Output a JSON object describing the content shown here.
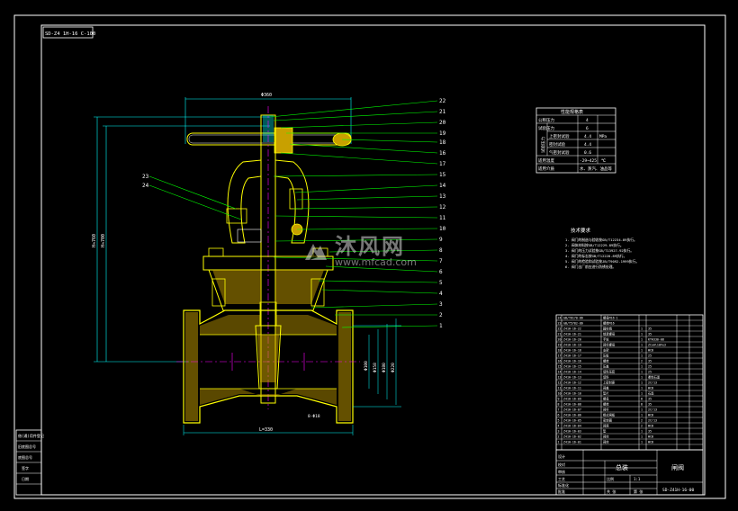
{
  "drawing": {
    "drawing_code": "SD-Z4 1H-16 C-100",
    "dims": {
      "handwheel_dia": "Φ360",
      "height_open": "H≈760",
      "height_closed": "H≈700",
      "length": "L=330",
      "bolt_holes": "8-Φ18",
      "flange_dias": [
        "Φ100",
        "Φ158",
        "Φ180",
        "Φ220"
      ]
    },
    "balloons": [
      "22",
      "21",
      "20",
      "19",
      "18",
      "16",
      "17",
      "15",
      "14",
      "13",
      "12",
      "11",
      "10",
      "9",
      "8",
      "7",
      "6",
      "5",
      "4",
      "3",
      "2",
      "1"
    ],
    "balloons_left": [
      "23",
      "24"
    ]
  },
  "perf_table": {
    "title": "性能规格表",
    "rows": [
      {
        "label": "公称压力",
        "value": "4",
        "unit": ""
      },
      {
        "label": "试验压力",
        "value": "6",
        "unit": ""
      },
      {
        "label": "上密封试验",
        "value": "4.4",
        "unit": "MPa"
      },
      {
        "label": "密封试验",
        "value": "4.4",
        "unit": ""
      },
      {
        "label": "气密封试验",
        "value": "0.6",
        "unit": ""
      }
    ],
    "side_label": "试验压力",
    "temp_label": "适用温度",
    "temp_value": "-29~425",
    "temp_unit": "℃",
    "media_label": "适用介质",
    "media_value": "水、蒸汽、油品等"
  },
  "tech_req": {
    "title": "技术要求",
    "items": [
      "1. 阀门的制造与验收按GB/T12234-89执行。",
      "2. 阀体材料按GB/T12229-89执行。",
      "3. 阀门的压力试验按GB/T13927-92执行。",
      "4. 阀门的标志按GB/T12220-89执行。",
      "5. 阀门的检验和试验按JB/T9092-1999执行。",
      "6. 阀门出厂前应进行防锈处理。"
    ]
  },
  "bom": {
    "rows": [
      {
        "no": "24",
        "code": "GB/T6170-86",
        "name": "螺母M16-1",
        "qty": "",
        "mat": ""
      },
      {
        "no": "23",
        "code": "GB/T5782-86",
        "name": "螺栓M16",
        "qty": "",
        "mat": ""
      },
      {
        "no": "22",
        "code": "Z41H-16-22",
        "name": "圆柱销",
        "qty": "1",
        "mat": "35"
      },
      {
        "no": "21",
        "code": "Z41H-16-21",
        "name": "锁紧螺母",
        "qty": "1",
        "mat": "35"
      },
      {
        "no": "20",
        "code": "Z41H-16-20",
        "name": "手轮",
        "qty": "1",
        "mat": "KTH330-08"
      },
      {
        "no": "19",
        "code": "Z41H-16-19",
        "name": "阀杆螺母",
        "qty": "1",
        "mat": "ZCuAl10Fe3"
      },
      {
        "no": "18",
        "code": "Z41H-16-18",
        "name": "支架",
        "qty": "1",
        "mat": "WCB"
      },
      {
        "no": "17",
        "code": "Z41H-16-17",
        "name": "压板",
        "qty": "1",
        "mat": "25"
      },
      {
        "no": "16",
        "code": "Z41H-16-16",
        "name": "螺栓",
        "qty": "2",
        "mat": "35"
      },
      {
        "no": "15",
        "code": "Z41H-16-15",
        "name": "压盖",
        "qty": "1",
        "mat": "25"
      },
      {
        "no": "14",
        "code": "Z41H-16-14",
        "name": "填料压套",
        "qty": "1",
        "mat": "25"
      },
      {
        "no": "13",
        "code": "Z41H-16-13",
        "name": "填料",
        "qty": "1",
        "mat": "柔性石墨"
      },
      {
        "no": "12",
        "code": "Z41H-16-12",
        "name": "上密封座",
        "qty": "1",
        "mat": "2Cr13"
      },
      {
        "no": "11",
        "code": "Z41H-16-11",
        "name": "阀盖",
        "qty": "1",
        "mat": "WCB"
      },
      {
        "no": "10",
        "code": "Z41H-16-10",
        "name": "垫片",
        "qty": "1",
        "mat": "石墨"
      },
      {
        "no": "9",
        "code": "Z41H-16-09",
        "name": "螺母",
        "qty": "8",
        "mat": "35"
      },
      {
        "no": "8",
        "code": "Z41H-16-08",
        "name": "螺栓",
        "qty": "8",
        "mat": "35"
      },
      {
        "no": "7",
        "code": "Z41H-16-07",
        "name": "阀杆",
        "qty": "1",
        "mat": "2Cr13"
      },
      {
        "no": "6",
        "code": "Z41H-16-06",
        "name": "楔式闸板",
        "qty": "1",
        "mat": "WCB"
      },
      {
        "no": "5",
        "code": "Z41H-16-05",
        "name": "密封圈",
        "qty": "2",
        "mat": "2Cr13"
      },
      {
        "no": "4",
        "code": "Z41H-16-04",
        "name": "阀座",
        "qty": "2",
        "mat": "WCB"
      },
      {
        "no": "3",
        "code": "Z41H-16-03",
        "name": "垫",
        "qty": "1",
        "mat": "35"
      },
      {
        "no": "2",
        "code": "Z41H-16-02",
        "name": "阀体",
        "qty": "1",
        "mat": "WCB"
      },
      {
        "no": "1",
        "code": "Z41H-16-01",
        "name": "阀体",
        "qty": "1",
        "mat": "WCB"
      }
    ],
    "header": {
      "no": "序号",
      "code": "代号",
      "name": "名称",
      "qty": "数量",
      "mat": "材料"
    }
  },
  "title_block": {
    "assembly": "总装",
    "company": "闸阀",
    "drawing_no": "SD-Z41H-16-00",
    "cells": [
      "设计",
      "校对",
      "审核",
      "工艺",
      "标准化",
      "批准",
      "比例",
      "1:1",
      "共 张",
      "第 张"
    ]
  },
  "left_strip": {
    "labels": [
      "借(通)用件登记",
      "旧底图总号",
      "底图总号",
      "签字",
      "日期"
    ]
  },
  "watermark": {
    "brand_cn": "沐风网",
    "url": "www.mfcad.com"
  },
  "colors": {
    "background": "#000000",
    "frame": "#ffffff",
    "part": "#ffff00",
    "leader": "#00ff00",
    "dim": "#00ffff",
    "center": "#ff00ff",
    "hatch": "#c8a000"
  }
}
